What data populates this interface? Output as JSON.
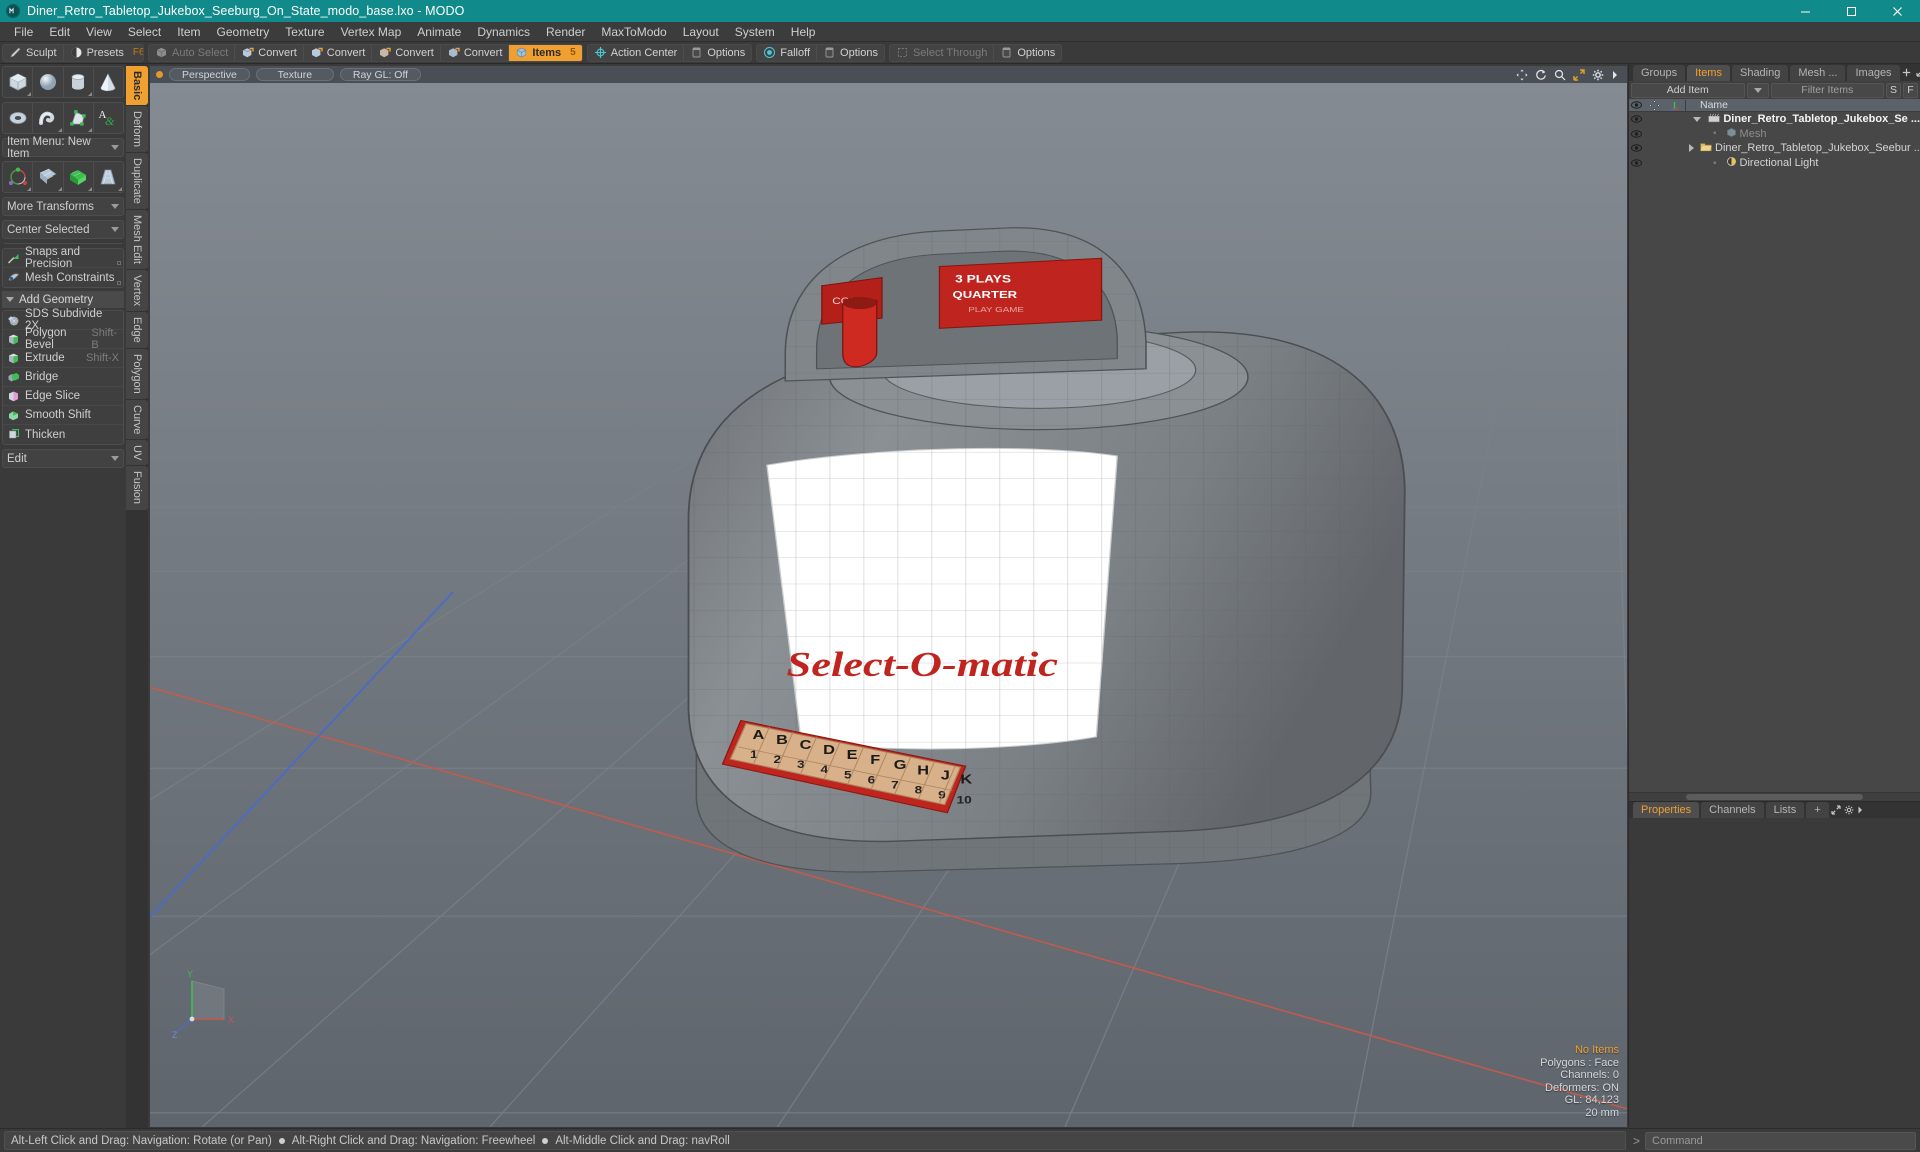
{
  "titlebar": {
    "title": "Diner_Retro_Tabletop_Jukebox_Seeburg_On_State_modo_base.lxo - MODO",
    "logo": "modo-logo-icon",
    "minimize": "minimize-icon",
    "maximize": "maximize-icon",
    "close": "close-icon"
  },
  "menubar": {
    "items": [
      {
        "label": "File"
      },
      {
        "label": "Edit"
      },
      {
        "label": "View"
      },
      {
        "label": "Select"
      },
      {
        "label": "Item"
      },
      {
        "label": "Geometry"
      },
      {
        "label": "Texture"
      },
      {
        "label": "Vertex Map"
      },
      {
        "label": "Animate"
      },
      {
        "label": "Dynamics"
      },
      {
        "label": "Render"
      },
      {
        "label": "MaxToModo"
      },
      {
        "label": "Layout"
      },
      {
        "label": "System"
      },
      {
        "label": "Help"
      }
    ]
  },
  "toolbar": {
    "groups": [
      {
        "buttons": [
          {
            "label": "Sculpt",
            "icon": "sculpt-brush-icon",
            "state": "normal",
            "hotkey": ""
          },
          {
            "label": "Presets",
            "icon": "presets-sphere-icon",
            "state": "normal",
            "hotkey": "F6"
          }
        ]
      },
      {
        "buttons": [
          {
            "label": "Auto Select",
            "icon": "cube-gray-icon",
            "state": "dim",
            "hotkey": ""
          },
          {
            "label": "Convert",
            "icon": "convert-vertex-icon",
            "state": "normal",
            "hotkey": ""
          },
          {
            "label": "Convert",
            "icon": "convert-edge-icon",
            "state": "normal",
            "hotkey": ""
          },
          {
            "label": "Convert",
            "icon": "convert-polygon-icon",
            "state": "normal",
            "hotkey": ""
          },
          {
            "label": "Convert",
            "icon": "convert-material-icon",
            "state": "normal",
            "hotkey": ""
          },
          {
            "label": "Items",
            "icon": "items-cube-icon",
            "state": "active",
            "hotkey": "5"
          }
        ]
      },
      {
        "buttons": [
          {
            "label": "Action Center",
            "icon": "action-center-icon",
            "state": "normal",
            "hotkey": ""
          },
          {
            "label": "Options",
            "icon": "options-panel-icon",
            "state": "normal",
            "hotkey": ""
          }
        ]
      },
      {
        "buttons": [
          {
            "label": "Falloff",
            "icon": "falloff-target-icon",
            "state": "normal",
            "hotkey": ""
          },
          {
            "label": "Options",
            "icon": "options-panel-icon",
            "state": "normal",
            "hotkey": ""
          }
        ]
      },
      {
        "buttons": [
          {
            "label": "Select Through",
            "icon": "select-through-icon",
            "state": "dim",
            "hotkey": ""
          },
          {
            "label": "Options",
            "icon": "options-panel-icon",
            "state": "normal",
            "hotkey": ""
          }
        ]
      }
    ]
  },
  "left_panel": {
    "primitive_row_1": [
      {
        "name": "cube-primitive-icon"
      },
      {
        "name": "sphere-primitive-icon"
      },
      {
        "name": "cylinder-primitive-icon"
      },
      {
        "name": "cone-primitive-icon"
      }
    ],
    "primitive_row_2": [
      {
        "name": "torus-primitive-icon"
      },
      {
        "name": "tube-primitive-icon"
      },
      {
        "name": "polygon-tool-icon"
      },
      {
        "name": "text-tool-icon"
      }
    ],
    "item_menu": "Item Menu: New Item",
    "transform_row": [
      {
        "name": "transform-gizmo-icon"
      },
      {
        "name": "grid-plane-icon"
      },
      {
        "name": "bend-deform-icon"
      },
      {
        "name": "taper-deform-icon"
      }
    ],
    "more_transforms": "More Transforms",
    "center_selected": "Center Selected",
    "snaps": {
      "label": "Snaps and Precision",
      "icon": "snap-magnet-icon"
    },
    "mesh_constraints": {
      "label": "Mesh Constraints",
      "icon": "mesh-constraint-icon"
    },
    "add_geometry_header": "Add Geometry",
    "geometry_items": [
      {
        "label": "SDS Subdivide 2X",
        "shortcut": "",
        "icon": "sds-subdivide-icon"
      },
      {
        "label": "Polygon Bevel",
        "shortcut": "Shift-B",
        "icon": "polygon-bevel-icon"
      },
      {
        "label": "Extrude",
        "shortcut": "Shift-X",
        "icon": "extrude-icon"
      },
      {
        "label": "Bridge",
        "shortcut": "",
        "icon": "bridge-icon"
      },
      {
        "label": "Edge Slice",
        "shortcut": "",
        "icon": "edge-slice-icon"
      },
      {
        "label": "Smooth Shift",
        "shortcut": "",
        "icon": "smooth-shift-icon"
      },
      {
        "label": "Thicken",
        "shortcut": "",
        "icon": "thicken-icon"
      }
    ],
    "edit_dropdown": "Edit",
    "vertical_tabs": [
      {
        "label": "Basic",
        "active": true
      },
      {
        "label": "Deform",
        "active": false
      },
      {
        "label": "Duplicate",
        "active": false
      },
      {
        "label": "Mesh Edit",
        "active": false
      },
      {
        "label": "Vertex",
        "active": false
      },
      {
        "label": "Edge",
        "active": false
      },
      {
        "label": "Polygon",
        "active": false
      },
      {
        "label": "Curve",
        "active": false
      },
      {
        "label": "UV",
        "active": false
      },
      {
        "label": "Fusion",
        "active": false
      }
    ]
  },
  "viewport": {
    "header": {
      "indicator": "viewport-active-dot",
      "pills": [
        "Perspective",
        "Texture",
        "Ray GL: Off"
      ],
      "icons": [
        "move-viewport-icon",
        "rotate-viewport-icon",
        "zoom-viewport-icon",
        "fit-viewport-icon",
        "gear-icon",
        "chevron-right-icon"
      ]
    },
    "axis_gizmo": {
      "y": "Y",
      "x": "X",
      "z": "Z"
    },
    "stats": [
      {
        "text": "No Items",
        "highlight": true
      },
      {
        "text": "Polygons : Face",
        "highlight": false
      },
      {
        "text": "Channels: 0",
        "highlight": false
      },
      {
        "text": "Deformers: ON",
        "highlight": false
      },
      {
        "text": "GL: 84,123",
        "highlight": false
      },
      {
        "text": "20 mm",
        "highlight": false
      }
    ],
    "model_labels": {
      "badge_coin": "COIN",
      "badge_plays": "3 PLAYS",
      "badge_quarter": "QUARTER",
      "badge_play_game": "PLAY GAME",
      "brand": "Select-O-matic",
      "letter_keys": [
        "A",
        "B",
        "C",
        "D",
        "E",
        "F",
        "G",
        "H",
        "J",
        "K"
      ],
      "number_keys": [
        "1",
        "2",
        "3",
        "4",
        "5",
        "6",
        "7",
        "8",
        "9",
        "10"
      ]
    }
  },
  "right_panel": {
    "tabs": [
      {
        "label": "Groups",
        "active": false
      },
      {
        "label": "Items",
        "active": true
      },
      {
        "label": "Shading",
        "active": false
      },
      {
        "label": "Mesh ...",
        "active": false
      },
      {
        "label": "Images",
        "active": false
      }
    ],
    "tab_icons": [
      "plus-icon",
      "expand-icon",
      "gear-icon",
      "chevron-right-icon"
    ],
    "toolbar": {
      "add_item": "Add Item",
      "add_item_arrow": "chevron-down-icon",
      "filter_placeholder": "Filter Items",
      "s_button": "S",
      "f_button": "F"
    },
    "tree": {
      "columns": {
        "eye": "eye-icon",
        "move": "move-icon",
        "axis": "axis-icon",
        "name": "Name"
      },
      "rows": [
        {
          "name": "Diner_Retro_Tabletop_Jukebox_Se ...",
          "icon": "scene-clapper-icon",
          "indent": 0,
          "toggle": "tri-down",
          "selected": true,
          "dim": false
        },
        {
          "name": "Mesh",
          "icon": "mesh-cube-icon",
          "indent": 1,
          "toggle": "dot",
          "selected": false,
          "dim": true
        },
        {
          "name": "Diner_Retro_Tabletop_Jukebox_Seebur ...",
          "icon": "group-folder-icon",
          "indent": 1,
          "toggle": "tri-right",
          "selected": false,
          "dim": false
        },
        {
          "name": "Directional Light",
          "icon": "light-icon",
          "indent": 1,
          "toggle": "dot",
          "selected": false,
          "dim": false
        }
      ]
    },
    "props_tabs": [
      {
        "label": "Properties",
        "active": true
      },
      {
        "label": "Channels",
        "active": false
      },
      {
        "label": "Lists",
        "active": false
      },
      {
        "label": "+",
        "active": false
      }
    ],
    "props_icons": [
      "expand-icon",
      "gear-icon",
      "chevron-right-icon"
    ]
  },
  "statusbar": {
    "hints": [
      "Alt-Left Click and Drag: Navigation: Rotate (or Pan)",
      "Alt-Right Click and Drag: Navigation: Freewheel",
      "Alt-Middle Click and Drag: navRoll"
    ],
    "command_prompt": ">",
    "command_placeholder": "Command"
  },
  "colors": {
    "title_bar": "#118a8c",
    "accent_orange": "#f0a030",
    "panel_bg": "#3a3a3a",
    "viewport_top": "#7d838a",
    "model_red": "#c0241e"
  }
}
